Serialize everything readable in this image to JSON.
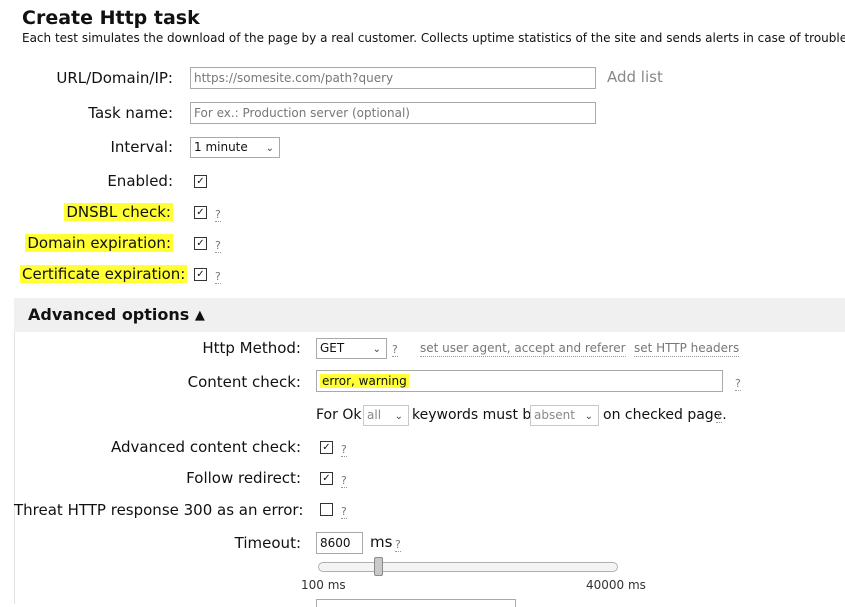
{
  "header": {
    "title": "Create Http task",
    "subtitle": "Each test simulates the download of the page by a real customer. Collects uptime statistics of the site and sends alerts in case of troubles."
  },
  "form": {
    "url_label": "URL/Domain/IP:",
    "url_placeholder": "https://somesite.com/path?query",
    "add_list": "Add list",
    "task_name_label": "Task name:",
    "task_name_placeholder": "For ex.: Production server (optional)",
    "interval_label": "Interval:",
    "interval_value": "1 minute",
    "enabled_label": "Enabled:",
    "dnsbl_label": "DNSBL check:",
    "domain_exp_label": "Domain expiration:",
    "cert_exp_label": "Certificate expiration:",
    "check_mark": "✓",
    "help": "?"
  },
  "advanced": {
    "title": "Advanced options",
    "http_method_label": "Http Method:",
    "http_method_value": "GET",
    "set_user_agent": "set user agent, accept and referer",
    "set_http_headers": "set HTTP headers",
    "content_check_label": "Content check:",
    "content_check_value": "error, warning",
    "for_ok_text": "For Ok",
    "for_ok_scope": "all",
    "keywords_text": "keywords must be",
    "keywords_mode": "absent",
    "on_checked_page": "on checked page.",
    "adv_content_label": "Advanced content check:",
    "follow_redirect_label": "Follow redirect:",
    "threat_300_label": "Threat HTTP response 300 as an error:",
    "timeout_label": "Timeout:",
    "timeout_value": "8600",
    "timeout_unit": "ms",
    "slider_min": "100 ms",
    "slider_max": "40000 ms",
    "slider_fraction": 0.21
  },
  "colors": {
    "highlight": "#ffff33",
    "section_bg": "#f0f0f0"
  },
  "icons": {
    "dropdown": "chevron-down-icon",
    "collapse": "chevron-up-icon"
  }
}
